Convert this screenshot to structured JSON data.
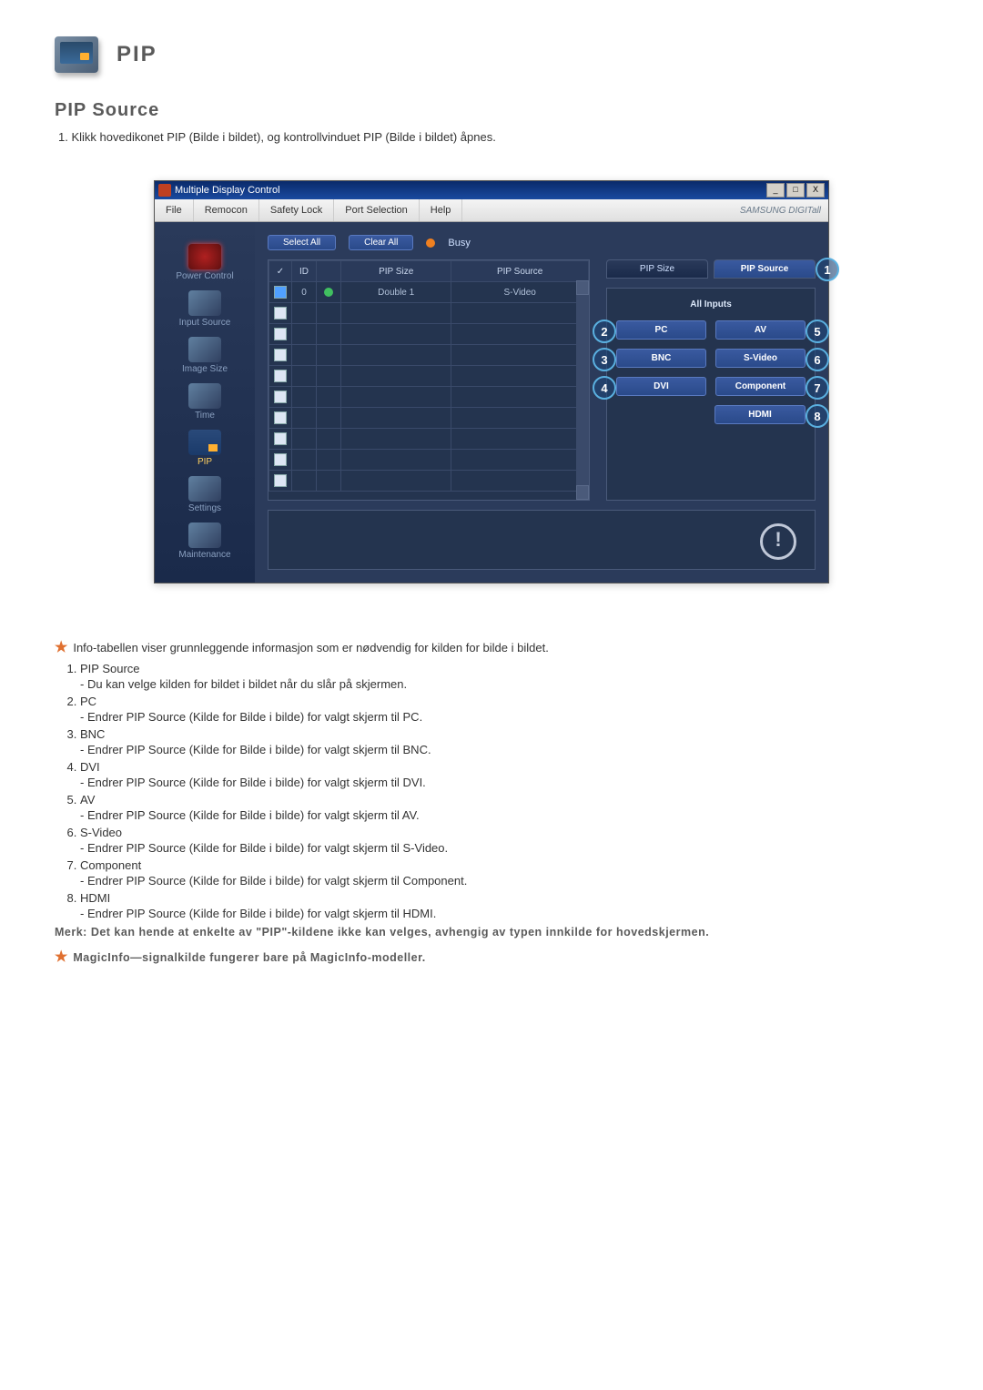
{
  "page_title": "PIP",
  "section_title": "PIP Source",
  "intro_items": [
    "Klikk hovedikonet PIP (Bilde i bildet), og kontrollvinduet PIP (Bilde i bildet) åpnes."
  ],
  "app": {
    "window_title": "Multiple Display Control",
    "win_buttons": {
      "min": "_",
      "max": "□",
      "close": "X"
    },
    "menu": [
      "File",
      "Remocon",
      "Safety Lock",
      "Port Selection",
      "Help"
    ],
    "brand": "SAMSUNG DIGITall",
    "sidebar": [
      {
        "label": "Power Control"
      },
      {
        "label": "Input Source"
      },
      {
        "label": "Image Size"
      },
      {
        "label": "Time"
      },
      {
        "label": "PIP"
      },
      {
        "label": "Settings"
      },
      {
        "label": "Maintenance"
      }
    ],
    "toolbar": {
      "select_all": "Select All",
      "clear_all": "Clear All",
      "busy": "Busy"
    },
    "grid": {
      "headers": {
        "chk": "✓",
        "id": "ID",
        "status": "",
        "size": "PIP Size",
        "source": "PIP Source"
      },
      "rows": [
        {
          "checked": true,
          "id": "0",
          "status": true,
          "size": "Double 1",
          "source": "S-Video"
        },
        {
          "checked": false,
          "id": "",
          "status": false,
          "size": "",
          "source": ""
        },
        {
          "checked": false,
          "id": "",
          "status": false,
          "size": "",
          "source": ""
        },
        {
          "checked": false,
          "id": "",
          "status": false,
          "size": "",
          "source": ""
        },
        {
          "checked": false,
          "id": "",
          "status": false,
          "size": "",
          "source": ""
        },
        {
          "checked": false,
          "id": "",
          "status": false,
          "size": "",
          "source": ""
        },
        {
          "checked": false,
          "id": "",
          "status": false,
          "size": "",
          "source": ""
        },
        {
          "checked": false,
          "id": "",
          "status": false,
          "size": "",
          "source": ""
        },
        {
          "checked": false,
          "id": "",
          "status": false,
          "size": "",
          "source": ""
        },
        {
          "checked": false,
          "id": "",
          "status": false,
          "size": "",
          "source": ""
        }
      ]
    },
    "tabs": {
      "size": "PIP Size",
      "source": "PIP Source"
    },
    "panel": {
      "title": "All Inputs",
      "buttons": {
        "pc": "PC",
        "av": "AV",
        "bnc": "BNC",
        "svideo": "S-Video",
        "dvi": "DVI",
        "component": "Component",
        "hdmi": "HDMI"
      }
    },
    "callouts": {
      "c1": "1",
      "c2": "2",
      "c3": "3",
      "c4": "4",
      "c5": "5",
      "c6": "6",
      "c7": "7",
      "c8": "8"
    }
  },
  "info_star": "Info-tabellen viser grunnleggende informasjon som er nødvendig for kilden for bilde i bildet.",
  "items": [
    {
      "t": "PIP Source",
      "s": "- Du kan velge kilden for bildet i bildet når du slår på skjermen."
    },
    {
      "t": "PC",
      "s": "- Endrer PIP Source (Kilde for Bilde i bilde) for valgt skjerm til PC."
    },
    {
      "t": "BNC",
      "s": "- Endrer PIP Source (Kilde for Bilde i bilde) for valgt skjerm til BNC."
    },
    {
      "t": "DVI",
      "s": "- Endrer PIP Source (Kilde for Bilde i bilde) for valgt skjerm til DVI."
    },
    {
      "t": "AV",
      "s": "- Endrer PIP Source (Kilde for Bilde i bilde) for valgt skjerm til AV."
    },
    {
      "t": "S-Video",
      "s": "- Endrer PIP Source (Kilde for Bilde i bilde) for valgt skjerm til S-Video."
    },
    {
      "t": "Component",
      "s": "- Endrer PIP Source (Kilde for Bilde i bilde) for valgt skjerm til Component."
    },
    {
      "t": "HDMI",
      "s": "- Endrer PIP Source (Kilde for Bilde i bilde) for valgt skjerm til HDMI."
    }
  ],
  "note_text": "Merk: Det kan hende at enkelte av \"PIP\"-kildene ikke kan velges, avhengig av typen innkilde for hovedskjermen.",
  "magic_note": "MagicInfo—signalkilde fungerer bare på MagicInfo-modeller."
}
